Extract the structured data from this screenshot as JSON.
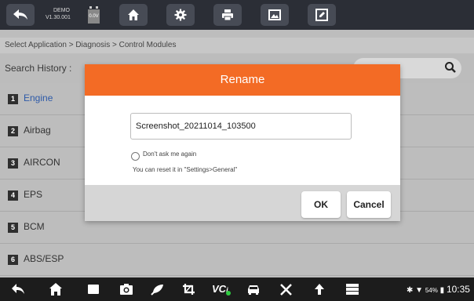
{
  "topbar": {
    "device_name": "DEMO",
    "version": "V1.30.001",
    "voltage": "0.0V",
    "icons": [
      "back-icon",
      "home-icon",
      "gear-icon",
      "printer-icon",
      "screenshot-icon",
      "edit-icon"
    ]
  },
  "breadcrumb": "Select Application > Diagnosis > Control Modules",
  "search": {
    "label": "Search History :",
    "placeholder": ""
  },
  "modules": [
    {
      "num": "1",
      "label": "Engine",
      "color": "#2e5aa8"
    },
    {
      "num": "2",
      "label": "Airbag",
      "color": "#333333"
    },
    {
      "num": "3",
      "label": "AIRCON",
      "color": "#333333"
    },
    {
      "num": "4",
      "label": "EPS",
      "color": "#333333"
    },
    {
      "num": "5",
      "label": "BCM",
      "color": "#333333"
    },
    {
      "num": "6",
      "label": "ABS/ESP",
      "color": "#333333"
    }
  ],
  "dialog": {
    "title": "Rename",
    "input_value": "Screenshot_20211014_103500",
    "checkbox_label": "Don't ask me again",
    "hint": "You can reset it in \"Settings>General\"",
    "ok_label": "OK",
    "cancel_label": "Cancel",
    "accent": "#f36b25"
  },
  "navbar": {
    "icons": [
      "back-icon",
      "home-icon",
      "recent-apps-icon",
      "camera-icon",
      "browser-icon",
      "crop-icon",
      "vci-icon",
      "car-icon",
      "tools-icon",
      "upload-icon",
      "menu-icon"
    ],
    "battery": "54%",
    "time": "10:35"
  }
}
